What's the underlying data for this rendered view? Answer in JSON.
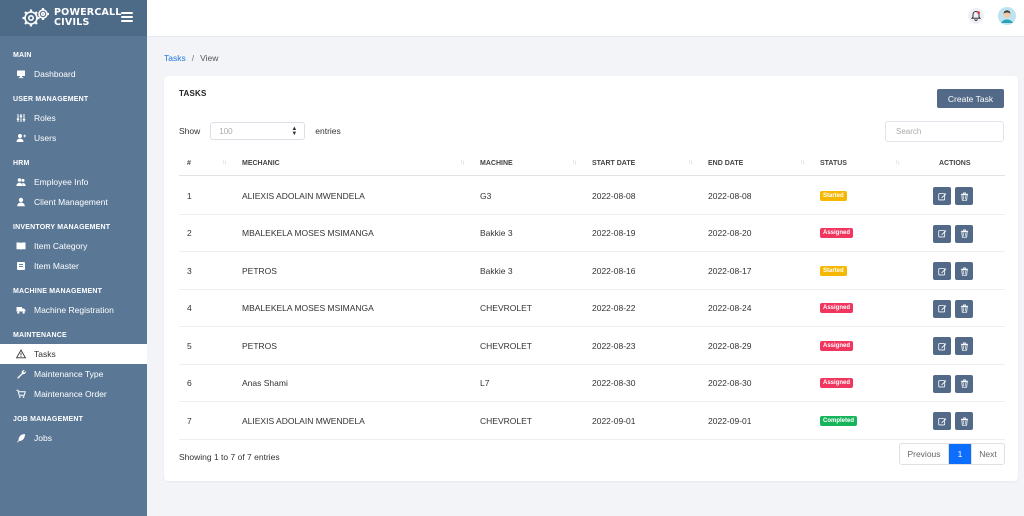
{
  "brand": {
    "line1": "POWERCALL",
    "line2": "CIVILS"
  },
  "sidebar": {
    "sections": [
      {
        "title": "MAIN",
        "items": [
          {
            "label": "Dashboard",
            "icon": "monitor-icon"
          }
        ]
      },
      {
        "title": "USER MANAGEMENT",
        "items": [
          {
            "label": "Roles",
            "icon": "sliders-icon"
          },
          {
            "label": "Users",
            "icon": "user-plus-icon"
          }
        ]
      },
      {
        "title": "HRM",
        "items": [
          {
            "label": "Employee Info",
            "icon": "users-icon"
          },
          {
            "label": "Client Management",
            "icon": "user-icon"
          }
        ]
      },
      {
        "title": "INVENTORY MANAGEMENT",
        "items": [
          {
            "label": "Item Category",
            "icon": "book-icon"
          },
          {
            "label": "Item Master",
            "icon": "box-icon"
          }
        ]
      },
      {
        "title": "MACHINE MANAGEMENT",
        "items": [
          {
            "label": "Machine Registration",
            "icon": "truck-icon"
          }
        ]
      },
      {
        "title": "MAINTENANCE",
        "items": [
          {
            "label": "Tasks",
            "icon": "warning-icon",
            "active": true
          },
          {
            "label": "Maintenance Type",
            "icon": "wrench-icon"
          },
          {
            "label": "Maintenance Order",
            "icon": "cart-icon"
          }
        ]
      },
      {
        "title": "JOB MANAGEMENT",
        "items": [
          {
            "label": "Jobs",
            "icon": "feather-icon"
          }
        ]
      }
    ]
  },
  "breadcrumb": {
    "link": "Tasks",
    "separator": "/",
    "current": "View"
  },
  "card": {
    "title": "TASKS",
    "create_label": "Create Task",
    "show_label": "Show",
    "entries_label": "entries",
    "page_size": "100",
    "search_placeholder": "Search"
  },
  "table": {
    "columns": [
      "#",
      "MECHANIC",
      "MACHINE",
      "START DATE",
      "END DATE",
      "STATUS",
      "ACTIONS"
    ],
    "rows": [
      {
        "id": "1",
        "mechanic": "ALIEXIS ADOLAIN MWENDELA",
        "machine": "G3",
        "start": "2022-08-08",
        "end": "2022-08-08",
        "status": "Started"
      },
      {
        "id": "2",
        "mechanic": "MBALEKELA MOSES MSIMANGA",
        "machine": "Bakkie 3",
        "start": "2022-08-19",
        "end": "2022-08-20",
        "status": "Assigned"
      },
      {
        "id": "3",
        "mechanic": "PETROS",
        "machine": "Bakkie 3",
        "start": "2022-08-16",
        "end": "2022-08-17",
        "status": "Started"
      },
      {
        "id": "4",
        "mechanic": "MBALEKELA MOSES MSIMANGA",
        "machine": "CHEVROLET",
        "start": "2022-08-22",
        "end": "2022-08-24",
        "status": "Assigned"
      },
      {
        "id": "5",
        "mechanic": "PETROS",
        "machine": "CHEVROLET",
        "start": "2022-08-23",
        "end": "2022-08-29",
        "status": "Assigned"
      },
      {
        "id": "6",
        "mechanic": "Anas Shami",
        "machine": "L7",
        "start": "2022-08-30",
        "end": "2022-08-30",
        "status": "Assigned"
      },
      {
        "id": "7",
        "mechanic": "ALIEXIS ADOLAIN MWENDELA",
        "machine": "CHEVROLET",
        "start": "2022-09-01",
        "end": "2022-09-01",
        "status": "Completed"
      }
    ]
  },
  "status_colors": {
    "Started": "#f5b700",
    "Assigned": "#f0365f",
    "Completed": "#18b45b"
  },
  "accent_color": "#526a87",
  "footer": {
    "showing": "Showing 1 to 7 of 7 entries",
    "prev": "Previous",
    "page": "1",
    "next": "Next"
  }
}
